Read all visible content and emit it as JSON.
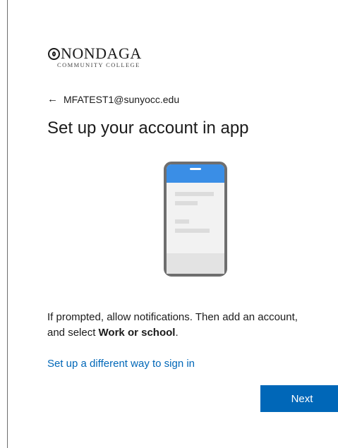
{
  "logo": {
    "wordmark": "NONDAGA",
    "subtitle": "COMMUNITY COLLEGE"
  },
  "account": {
    "back_icon": "arrow-left-icon",
    "email": "MFATEST1@sunyocc.edu"
  },
  "page": {
    "title": "Set up your account in app"
  },
  "illustration": {
    "icon": "phone-icon",
    "colors": {
      "frame": "#6e6e6e",
      "header": "#3a8ee6",
      "screen": "#f2f2f2",
      "lines": "#dcdcdc"
    }
  },
  "instruction": {
    "text": "If prompted, allow notifications. Then add an account, and select ",
    "bold": "Work or school",
    "suffix": "."
  },
  "links": {
    "alternate": "Set up a different way to sign in"
  },
  "buttons": {
    "next": "Next"
  },
  "colors": {
    "accent": "#0067b8"
  }
}
